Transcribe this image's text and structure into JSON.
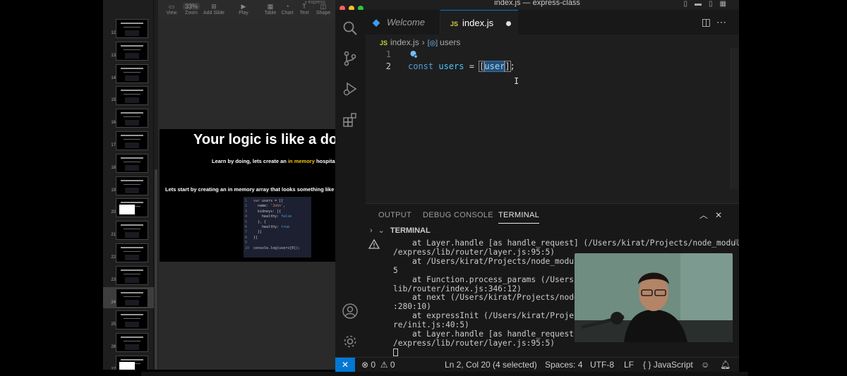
{
  "keynote": {
    "toolbar": {
      "zoom_value": "33%",
      "items": [
        {
          "label": "View",
          "icon": "view-icon"
        },
        {
          "label": "Zoom",
          "icon": "zoom-icon"
        },
        {
          "label": "Add Slide",
          "icon": "add-slide-icon"
        },
        {
          "label": "Play",
          "icon": "play-icon"
        },
        {
          "label": "Table",
          "icon": "table-icon"
        },
        {
          "label": "Chart",
          "icon": "chart-icon"
        },
        {
          "label": "Text",
          "icon": "text-icon"
        },
        {
          "label": "Shape",
          "icon": "shape-icon"
        }
      ],
      "doc_title": "express"
    },
    "thumbnails": [
      {
        "num": "12"
      },
      {
        "num": "13"
      },
      {
        "num": "14"
      },
      {
        "num": "15"
      },
      {
        "num": "16"
      },
      {
        "num": "17"
      },
      {
        "num": "18"
      },
      {
        "num": "19"
      },
      {
        "num": "20",
        "white": true
      },
      {
        "num": "21"
      },
      {
        "num": "22"
      },
      {
        "num": "23"
      },
      {
        "num": "24",
        "selected": true
      },
      {
        "num": "25"
      },
      {
        "num": "26"
      },
      {
        "num": "27",
        "white": true
      }
    ],
    "slide": {
      "title": "Your logic is like a doc",
      "subtitle_before": "Learn by doing, lets create an ",
      "subtitle_highlight": "in memory",
      "subtitle_after": " hospita",
      "subtitle2": "Lets start by creating an in memory array that looks something like",
      "code_lines": [
        {
          "n": "1",
          "parts": [
            {
              "t": "var ",
              "c": "kw"
            },
            {
              "t": "users = [{",
              "c": ""
            }
          ]
        },
        {
          "n": "2",
          "parts": [
            {
              "t": "  name: ",
              "c": ""
            },
            {
              "t": "'John'",
              "c": "str"
            },
            {
              "t": ",",
              "c": ""
            }
          ]
        },
        {
          "n": "3",
          "parts": [
            {
              "t": "  kidneys: [{",
              "c": ""
            }
          ]
        },
        {
          "n": "4",
          "parts": [
            {
              "t": "    healthy: ",
              "c": ""
            },
            {
              "t": "false",
              "c": "bool"
            }
          ]
        },
        {
          "n": "5",
          "parts": [
            {
              "t": "  }, {",
              "c": ""
            }
          ]
        },
        {
          "n": "6",
          "parts": [
            {
              "t": "    healthy: ",
              "c": ""
            },
            {
              "t": "true",
              "c": "bool"
            }
          ]
        },
        {
          "n": "7",
          "parts": [
            {
              "t": "  }]",
              "c": ""
            }
          ]
        },
        {
          "n": "8",
          "parts": [
            {
              "t": "}]",
              "c": ""
            }
          ]
        },
        {
          "n": "9",
          "parts": [
            {
              "t": "",
              "c": ""
            }
          ]
        },
        {
          "n": "10",
          "parts": [
            {
              "t": "console.log(users[0]);",
              "c": ""
            }
          ]
        }
      ]
    }
  },
  "vscode": {
    "window_title": "index.js — express-class",
    "tabs": [
      {
        "label": "Welcome",
        "active": false
      },
      {
        "label": "index.js",
        "active": true,
        "dirty": true,
        "badge": "JS"
      }
    ],
    "breadcrumb": {
      "file": "index.js",
      "symbol": "users",
      "badge": "JS"
    },
    "editor": {
      "line_numbers": [
        "1",
        "2"
      ],
      "line2": {
        "kw": "const",
        "var": "users",
        "eq": " = ",
        "open": "[",
        "sel": "user",
        "close": "]",
        "end": ";"
      }
    },
    "panel": {
      "tabs": [
        "OUTPUT",
        "DEBUG CONSOLE",
        "TERMINAL"
      ],
      "active_tab": "TERMINAL",
      "terminal_label": "TERMINAL",
      "lines": [
        "    at Layer.handle [as handle_request] (/Users/kirat/Projects/node_modules",
        "/express/lib/router/layer.js:95:5)",
        "    at /Users/kirat/Projects/node_modules",
        "5",
        "    at Function.process_params (/Users/ki",
        "lib/router/index.js:346:12)",
        "    at next (/Users/kirat/Projects/node_m",
        ":280:10)",
        "    at expressInit (/Users/kirat/Projects",
        "re/init.js:40:5)",
        "    at Layer.handle [as handle_request] (",
        "/express/lib/router/layer.js:95:5)"
      ]
    },
    "status": {
      "errors": "0",
      "warnings": "0",
      "position": "Ln 2, Col 20 (4 selected)",
      "spaces": "Spaces: 4",
      "encoding": "UTF-8",
      "eol": "LF",
      "language": "JavaScript",
      "language_icon": "{ }"
    }
  }
}
